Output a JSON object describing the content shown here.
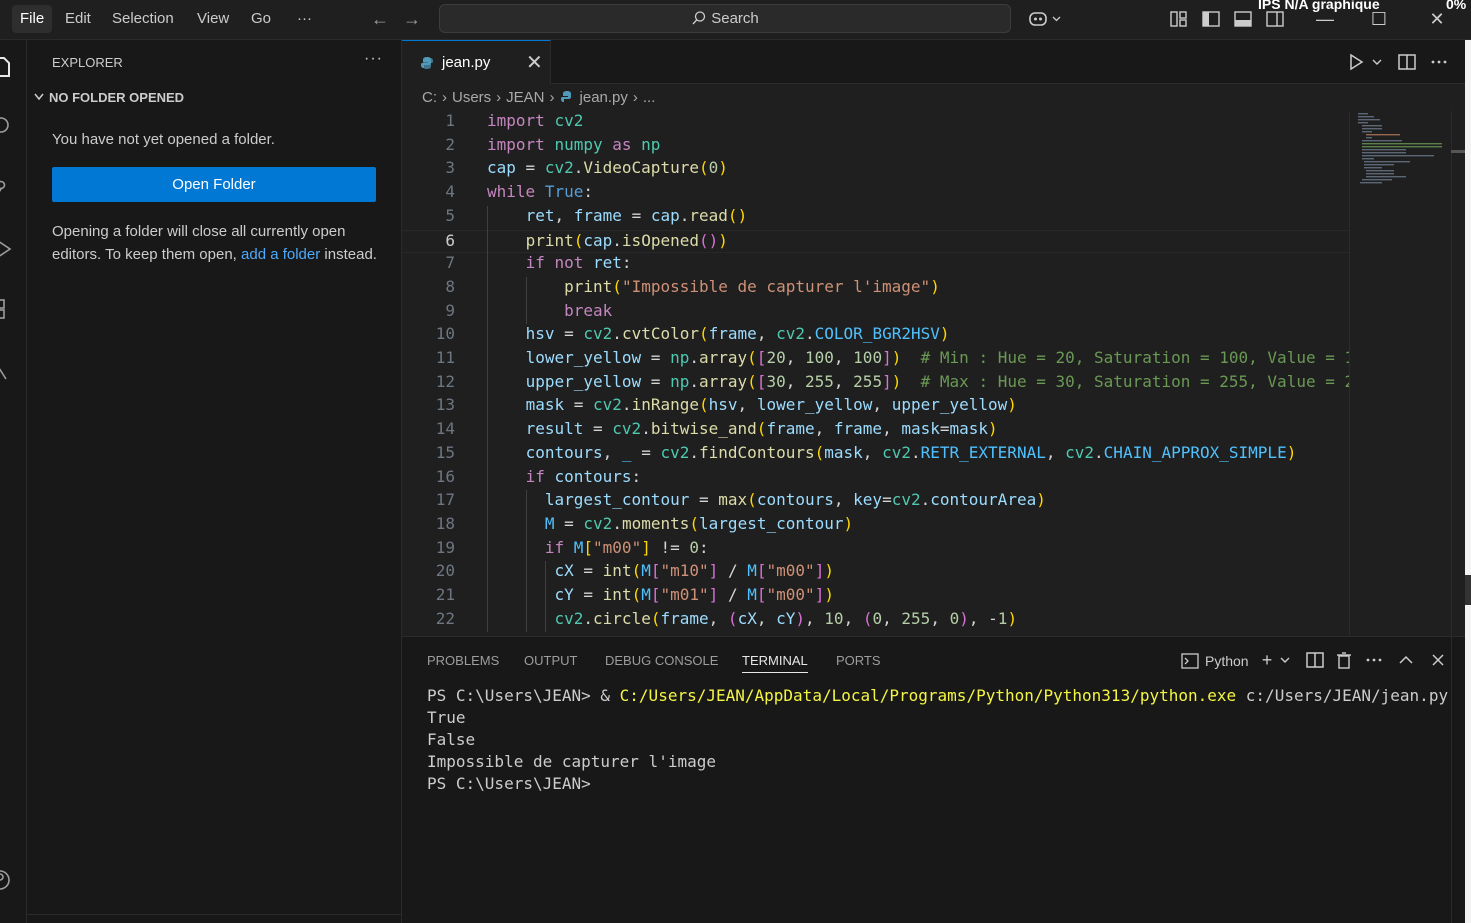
{
  "menu": [
    "File",
    "Edit",
    "Selection",
    "View",
    "Go",
    "···"
  ],
  "search": {
    "label": "Search"
  },
  "system": {
    "status_text": "IPS  N/A  graphique",
    "percent": "0%"
  },
  "explorer": {
    "title": "EXPLORER",
    "more": "···",
    "section": "NO FOLDER OPENED",
    "message": "You have not yet opened a folder.",
    "open_folder_label": "Open Folder",
    "note_before": "Opening a folder will close all currently open editors. To keep them open, ",
    "note_link": "add a folder",
    "note_after": " instead."
  },
  "tab": {
    "label": "jean.py",
    "close": "✕"
  },
  "breadcrumb": [
    "C:",
    "Users",
    "JEAN",
    "jean.py",
    "..."
  ],
  "editor": {
    "current_line": 6,
    "lines": [
      "import cv2",
      "import numpy as np",
      "cap = cv2.VideoCapture(0)",
      "while True:",
      "    ret, frame = cap.read()",
      "    print(cap.isOpened())",
      "    if not ret:",
      "        print(\"Impossible de capturer l'image\")",
      "        break",
      "    hsv = cv2.cvtColor(frame, cv2.COLOR_BGR2HSV)",
      "    lower_yellow = np.array([20, 100, 100])  # Min : Hue = 20, Saturation = 100, Value = 1",
      "    upper_yellow = np.array([30, 255, 255])  # Max : Hue = 30, Saturation = 255, Value = 2",
      "    mask = cv2.inRange(hsv, lower_yellow, upper_yellow)",
      "    result = cv2.bitwise_and(frame, frame, mask=mask)",
      "    contours, _ = cv2.findContours(mask, cv2.RETR_EXTERNAL, cv2.CHAIN_APPROX_SIMPLE)",
      "    if contours:",
      "      largest_contour = max(contours, key=cv2.contourArea)",
      "      M = cv2.moments(largest_contour)",
      "      if M[\"m00\"] != 0:",
      "       cX = int(M[\"m10\"] / M[\"m00\"])",
      "       cY = int(M[\"m01\"] / M[\"m00\"])",
      "       cv2.circle(frame, (cX, cY), 10, (0, 255, 0), -1)"
    ]
  },
  "panel": {
    "tabs": [
      "PROBLEMS",
      "OUTPUT",
      "DEBUG CONSOLE",
      "TERMINAL",
      "PORTS"
    ],
    "active_tab": "TERMINAL",
    "terminal_kind": "Python",
    "terminal": {
      "prompt": "PS C:\\Users\\JEAN> ",
      "amp": "& ",
      "exe": "C:/Users/JEAN/AppData/Local/Programs/Python/Python313/python.exe",
      "arg": " c:/Users/JEAN/jean.py",
      "out1": "True",
      "out2": "False",
      "out3": "Impossible de capturer l'image",
      "prompt2": "PS C:\\Users\\JEAN>"
    }
  },
  "colors": {
    "accent": "#0078d4",
    "link": "#4daafc",
    "terminal_path": "#f5f543"
  }
}
